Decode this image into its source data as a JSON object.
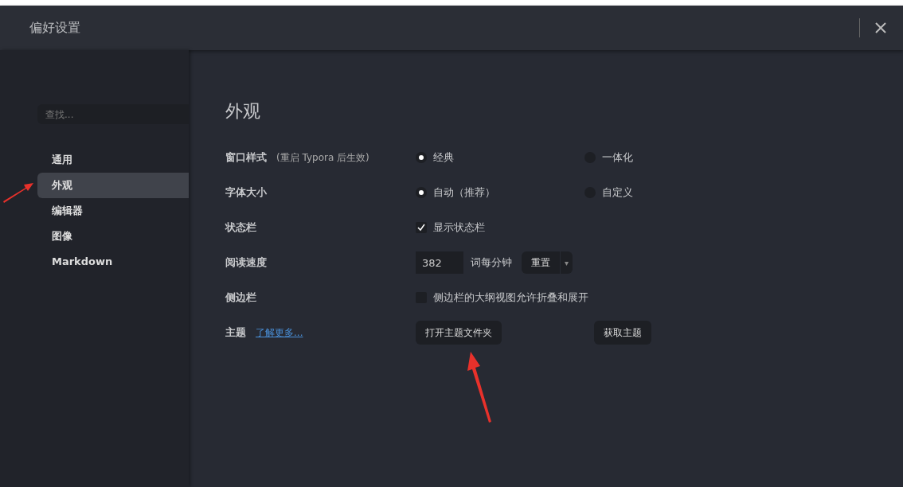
{
  "window": {
    "title": "偏好设置"
  },
  "sidebar": {
    "search": {
      "placeholder": "查找..."
    },
    "items": [
      {
        "label": "通用",
        "selected": false
      },
      {
        "label": "外观",
        "selected": true
      },
      {
        "label": "编辑器",
        "selected": false
      },
      {
        "label": "图像",
        "selected": false
      },
      {
        "label": "Markdown",
        "selected": false
      }
    ]
  },
  "section_title": "外观",
  "settings": [
    {
      "kind": "radio",
      "label": "窗口样式",
      "note": "(重启 Typora 后生效)",
      "options": [
        {
          "label": "经典",
          "selected": true
        },
        {
          "label": "一体化",
          "selected": false
        }
      ]
    },
    {
      "kind": "radio",
      "label": "字体大小",
      "options": [
        {
          "label": "自动（推荐）",
          "selected": true
        },
        {
          "label": "自定义",
          "selected": false
        }
      ]
    },
    {
      "kind": "checkbox",
      "label": "状态栏",
      "option": {
        "label": "显示状态栏",
        "checked": true
      }
    },
    {
      "kind": "number",
      "label": "阅读速度",
      "value": "382",
      "unit": "词每分钟",
      "button": "重置",
      "caret": "▾"
    },
    {
      "kind": "checkbox",
      "label": "侧边栏",
      "option": {
        "label": "侧边栏的大纲视图允许折叠和展开",
        "checked": false
      }
    },
    {
      "kind": "theme",
      "label": "主题",
      "link": "了解更多...",
      "buttons": [
        "打开主题文件夹",
        "获取主题"
      ]
    }
  ]
}
